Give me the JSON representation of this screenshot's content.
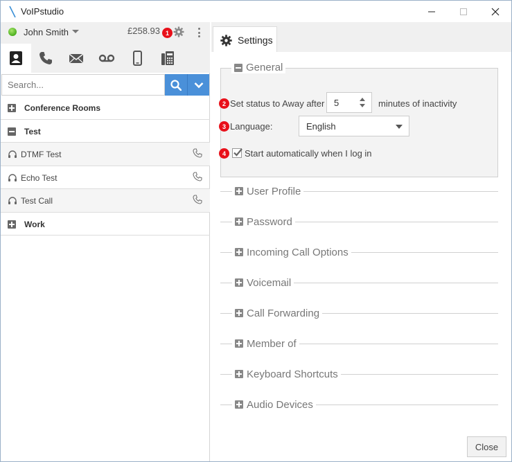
{
  "window": {
    "title": "VoIPstudio"
  },
  "user": {
    "name": "John Smith",
    "balance": "£258.93"
  },
  "search": {
    "placeholder": "Search..."
  },
  "contacts": {
    "groups": [
      {
        "label": "Conference Rooms"
      },
      {
        "label": "Test"
      },
      {
        "label": "Work"
      }
    ],
    "items": [
      {
        "label": "DTMF Test"
      },
      {
        "label": "Echo Test"
      },
      {
        "label": "Test Call"
      }
    ]
  },
  "settings": {
    "tab_label": "Settings",
    "general": {
      "legend": "General",
      "away_prefix": "Set status to Away after",
      "away_value": "5",
      "away_suffix": "minutes of inactivity",
      "language_label": "Language:",
      "language_value": "English",
      "autostart_label": "Start automatically when I log in",
      "autostart_checked": true
    },
    "sections": [
      {
        "label": "User Profile"
      },
      {
        "label": "Password"
      },
      {
        "label": "Incoming Call Options"
      },
      {
        "label": "Voicemail"
      },
      {
        "label": "Call Forwarding"
      },
      {
        "label": "Member of"
      },
      {
        "label": "Keyboard Shortcuts"
      },
      {
        "label": "Audio Devices"
      }
    ],
    "close_label": "Close"
  },
  "badges": [
    "1",
    "2",
    "3",
    "4"
  ],
  "colors": {
    "accent": "#4a90d9",
    "badge": "#e8101a",
    "status": "#4caf1f"
  }
}
